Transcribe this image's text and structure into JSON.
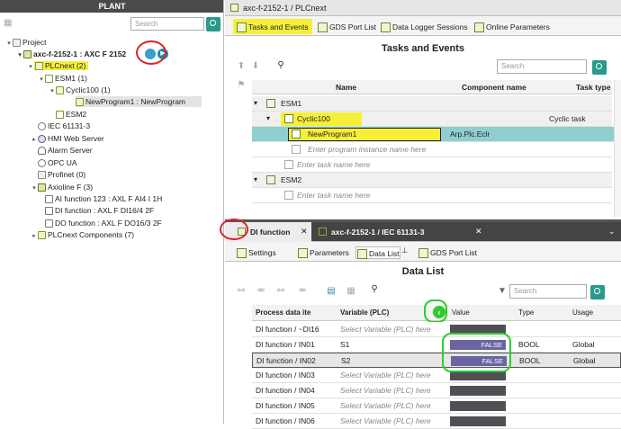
{
  "plant": {
    "header": "PLANT",
    "search_placeholder": "Search",
    "tree": [
      {
        "label": "Project"
      },
      {
        "label": "axc-f-2152-1 : AXC F 2152"
      },
      {
        "label": "PLCnext (2)"
      },
      {
        "label": "ESM1 (1)"
      },
      {
        "label": "Cyclic100 (1)"
      },
      {
        "label": "NewProgram1 : NewProgram"
      },
      {
        "label": "ESM2"
      },
      {
        "label": "IEC 61131-3"
      },
      {
        "label": "HMI Web Server"
      },
      {
        "label": "Alarm Server"
      },
      {
        "label": "OPC UA"
      },
      {
        "label": "Profinet (0)"
      },
      {
        "label": "Axioline F (3)"
      },
      {
        "label": "AI function 123 : AXL F AI4 I 1H"
      },
      {
        "label": "DI function : AXL F DI16/4 2F"
      },
      {
        "label": "DO function : AXL F DO16/3 2F"
      },
      {
        "label": "PLCnext Components (7)"
      }
    ]
  },
  "top": {
    "window_tab": "axc-f-2152-1 / PLCnext",
    "subtabs": [
      "Tasks and Events",
      "GDS Port List",
      "Data Logger Sessions",
      "Online Parameters"
    ],
    "title": "Tasks and Events",
    "search_placeholder": "Search",
    "columns": [
      "Name",
      "Component name",
      "Task type"
    ],
    "rows": [
      {
        "name": "ESM1",
        "component": "",
        "type": ""
      },
      {
        "name": "Cyclic100",
        "component": "",
        "type": "Cyclic task"
      },
      {
        "name": "NewProgram1",
        "component": "Arp.Plc.Eclr",
        "type": ""
      },
      {
        "name": "Enter program instance name here",
        "component": "",
        "type": ""
      },
      {
        "name": "Enter task name here",
        "component": "",
        "type": ""
      },
      {
        "name": "ESM2",
        "component": "",
        "type": ""
      },
      {
        "name": "Enter task name here",
        "component": "",
        "type": ""
      }
    ]
  },
  "bottom": {
    "window_tabs": [
      "DI function",
      "axc-f-2152-1 / IEC 61131-3"
    ],
    "subtabs": [
      "Settings",
      "Parameters",
      "Data List",
      "GDS Port List"
    ],
    "title": "Data List",
    "search_placeholder": "Search",
    "columns": [
      "Process data ite",
      "Variable (PLC)",
      "Value",
      "Type",
      "Usage"
    ],
    "rows": [
      {
        "item": "DI function / ~DI16",
        "variable": "Select Variable (PLC) here",
        "value": "",
        "type": "",
        "usage": ""
      },
      {
        "item": "DI function / IN01",
        "variable": "S1",
        "value": "FALSE",
        "type": "BOOL",
        "usage": "Global"
      },
      {
        "item": "DI function / IN02",
        "variable": "S2",
        "value": "FALSE",
        "type": "BOOL",
        "usage": "Global"
      },
      {
        "item": "DI function / IN03",
        "variable": "Select Variable (PLC) here",
        "value": "",
        "type": "",
        "usage": ""
      },
      {
        "item": "DI function / IN04",
        "variable": "Select Variable (PLC) here",
        "value": "",
        "type": "",
        "usage": ""
      },
      {
        "item": "DI function / IN05",
        "variable": "Select Variable (PLC) here",
        "value": "",
        "type": "",
        "usage": ""
      },
      {
        "item": "DI function / IN06",
        "variable": "Select Variable (PLC) here",
        "value": "",
        "type": "",
        "usage": ""
      }
    ]
  },
  "colors": {
    "highlight": "#f5ef3a",
    "selected_row": "#8fcfd0",
    "annotation_red": "#e0202a",
    "annotation_green": "#2ecc2e",
    "value_bar": "#6a65a0"
  }
}
